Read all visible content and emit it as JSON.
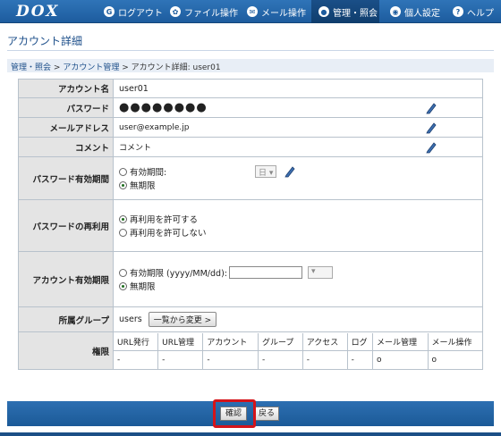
{
  "header": {
    "logo": "DOX",
    "nav": [
      {
        "label": "ログアウト",
        "icon": "G"
      },
      {
        "label": "ファイル操作",
        "icon": "✿"
      },
      {
        "label": "メール操作",
        "icon": "✉"
      },
      {
        "label": "管理・照会",
        "icon": "●"
      },
      {
        "label": "個人設定",
        "icon": "◉"
      },
      {
        "label": "ヘルプ",
        "icon": "?"
      }
    ]
  },
  "page": {
    "title": "アカウント詳細",
    "breadcrumb": [
      "管理・照会",
      ">",
      "アカウント管理",
      "> アカウント詳細: user01"
    ]
  },
  "form": {
    "account_name_label": "アカウント名",
    "account_name": "user01",
    "password_label": "パスワード",
    "password": "●●●●●●●●",
    "email_label": "メールアドレス",
    "email": "user@example.jp",
    "comment_label": "コメント",
    "comment": "コメント",
    "pw_expiry_label": "パスワード有効期間",
    "pw_expiry_option1": "有効期間:",
    "pw_expiry_unit": "日",
    "pw_expiry_option2": "無期限",
    "pw_reuse_label": "パスワードの再利用",
    "pw_reuse_option1": "再利用を許可する",
    "pw_reuse_option2": "再利用を許可しない",
    "acct_expiry_label": "アカウント有効期限",
    "acct_expiry_option1": "有効期限 (yyyy/MM/dd):",
    "acct_expiry_option2": "無期限",
    "group_label": "所属グループ",
    "group_value": "users",
    "group_button": "一覧から変更 >",
    "perm_label": "権限",
    "perm_headers": [
      "URL発行",
      "URL管理",
      "アカウント",
      "グループ",
      "アクセス",
      "ログ",
      "メール管理",
      "メール操作"
    ],
    "perm_values": [
      "-",
      "-",
      "-",
      "-",
      "-",
      "-",
      "o",
      "o"
    ]
  },
  "footer": {
    "confirm": "確認",
    "back": "戻る"
  },
  "colors": {
    "nav_bg": "#2f74b8",
    "highlight": "#d4141a"
  }
}
